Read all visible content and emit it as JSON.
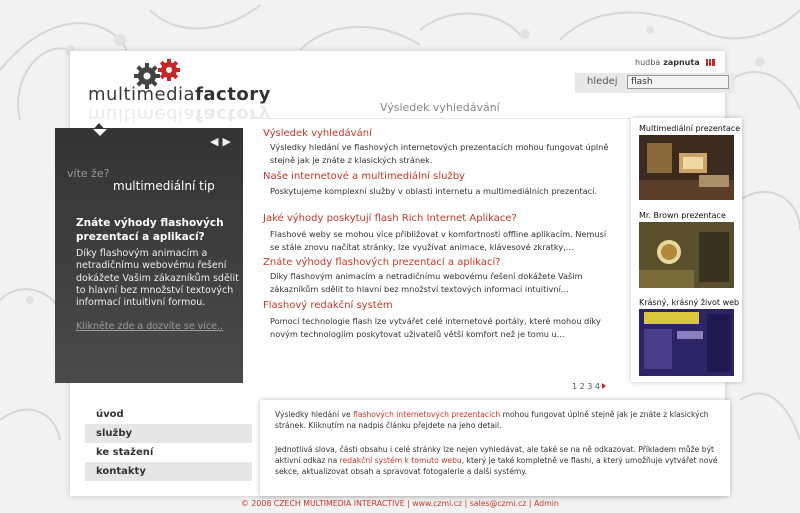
{
  "brand": {
    "name_light": "multimedia",
    "name_bold": "factory"
  },
  "music": {
    "label": "hudba",
    "state": "zapnuta"
  },
  "search": {
    "label": "hledej",
    "value": "flash"
  },
  "page_title": "Výsledek vyhledávání",
  "tip": {
    "prefix": "víte že?",
    "title": "multimediální tip",
    "heading": "Znáte výhody flashových prezentací a aplikací?",
    "body": "Díky flashovým animacím a netradičnímu webovému řešení dokážete Vašim zákazníkům sdělit to hlavní bez  množství textových informací intuitivní formou.",
    "link": "Klikněte zde a dozvíte se více..",
    "nav_prev": "◀",
    "nav_next": "▶"
  },
  "results": [
    {
      "title": "Výsledek vyhledávání",
      "text": "Výsledky hledání ve flashových internetových prezentacích mohou fungovat úplně stejně jak je znáte z klasických stránek."
    },
    {
      "title": "Naše internetové a multimediální služby",
      "text": "Poskytujeme komplexní služby v oblasti internetu a multimediálních prezentací."
    },
    {
      "title": "Jaké výhody poskytují flash Rich Internet Aplikace?",
      "text": "Flashové weby se mohou více přibližovat v komfortnosti offline aplikacím. Nemusí se stále znovu načítat stránky, lze využívat animace, klávesové zkratky,..."
    },
    {
      "title": "Znáte výhody flashových prezentací a aplikací?",
      "text": "Díky flashovým animacím a netradičnímu webovému řešení dokážete Vašim zákazníkům sdělit to hlavní bez  množství textových informací intuitivní..."
    },
    {
      "title": "Flashový redakční systém",
      "text": "Pomocí technologie flash lze vytvářet celé internetové portály, které mohou díky novým technologiím poskytovat uživatelů větší komfort než je tomu u..."
    }
  ],
  "pagination": {
    "pages": "1 2 3 4"
  },
  "references": [
    {
      "label": "Multimediální prezentace"
    },
    {
      "label": "Mr. Brown prezentace"
    },
    {
      "label": "Krásný, krásný život web"
    }
  ],
  "nav": [
    "úvod",
    "služby",
    "ke stažení",
    "kontakty"
  ],
  "info": {
    "p1_a": "Výsledky hledání ve ",
    "p1_link": "flashových internetových prezentacích",
    "p1_b": " mohou fungovat úplně stejně jak je znáte z klasických stránek. Kliknutím na nadpis článku přejdete na jeho detail.",
    "p2_a": "Jednotlivá slova, části obsahu i celé stránky lze nejen vyhledávat, ale také se na ně odkazovat. Příkladem může být aktivní odkaz na ",
    "p2_link": "redakční systém k tomuto webu",
    "p2_b": ", který je také kompletně ve flashi, a který umožňuje vytvářet nové sekce, aktualizovat obsah a spravovat fotogalerie a další systémy."
  },
  "footer": "© 2008 CZECH MULTIMEDIA INTERACTIVE | www.czmi.cz | sales@czmi.cz | Admin",
  "colors": {
    "accent": "#c0392b",
    "tip_bg": "#3a3a3a"
  }
}
